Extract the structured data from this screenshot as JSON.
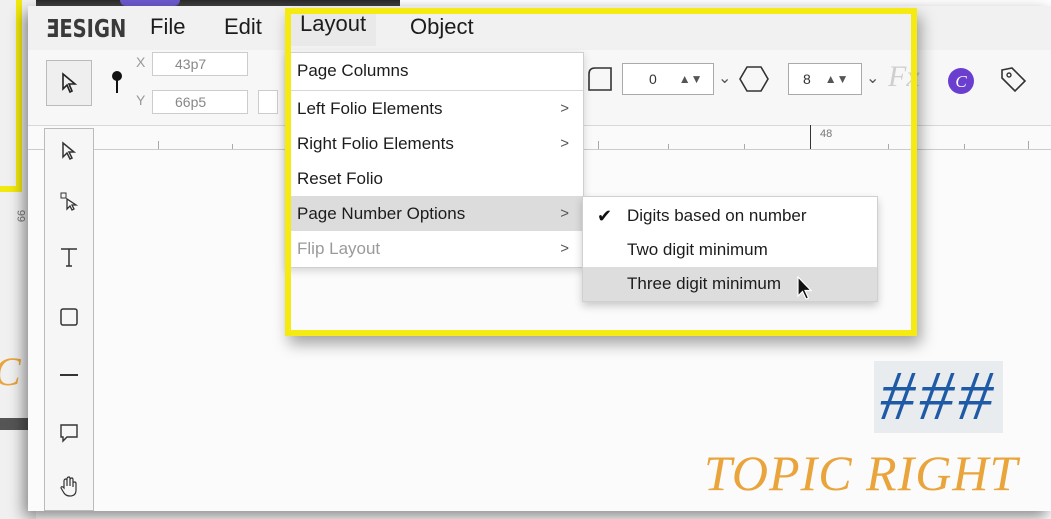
{
  "app": {
    "logo": "ƎESIGN",
    "menus": [
      {
        "label": "File"
      },
      {
        "label": "Edit"
      },
      {
        "label": "Layout"
      },
      {
        "label": "Object"
      }
    ]
  },
  "toolbar": {
    "x_label": "X",
    "x_value": "43p7",
    "y_label": "Y",
    "y_value": "66p5",
    "corner_value": "0",
    "polygon_value": "8",
    "fx_label": "Fx"
  },
  "ruler": {
    "mark": "48"
  },
  "left_ruler": {
    "mark": "66"
  },
  "layout_menu": {
    "items": [
      {
        "label": "Page Columns",
        "submenu": false
      },
      {
        "label": "Left Folio Elements",
        "submenu": true
      },
      {
        "label": "Right Folio Elements",
        "submenu": true
      },
      {
        "label": "Reset Folio",
        "submenu": false
      },
      {
        "label": "Page Number Options",
        "submenu": true
      },
      {
        "label": "Flip Layout",
        "submenu": true
      }
    ],
    "arrow": ">"
  },
  "page_number_submenu": {
    "items": [
      {
        "label": "Digits based on number",
        "checked": true
      },
      {
        "label": "Two digit minimum",
        "checked": false
      },
      {
        "label": "Three digit minimum",
        "checked": false
      }
    ],
    "check_glyph": "✔"
  },
  "canvas": {
    "hash_text": "###",
    "topic_text": "TOPIC RIGHT"
  },
  "colors": {
    "highlight": "#f5ea12",
    "hash": "#1f5aa6",
    "topic": "#e9a43c",
    "canva_badge": "#6a3fd0"
  }
}
